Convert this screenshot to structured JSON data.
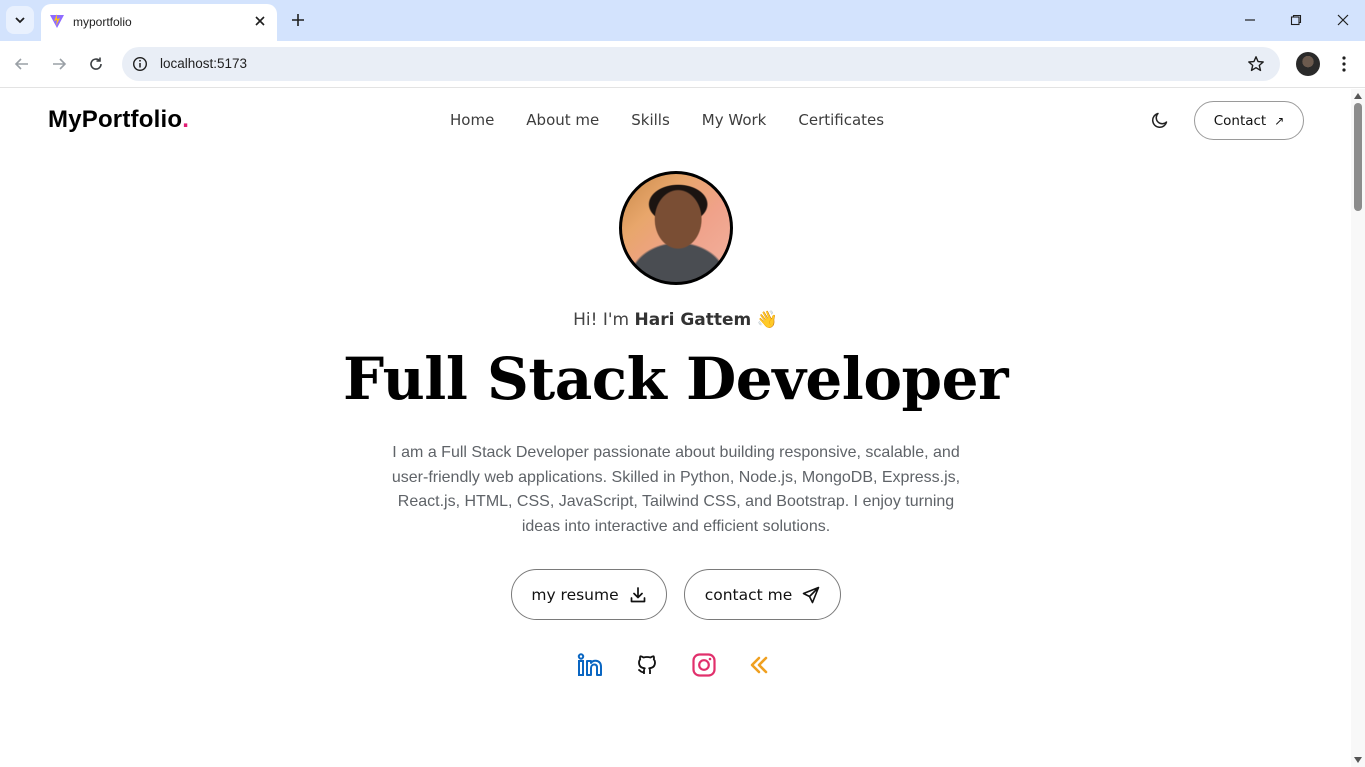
{
  "browser": {
    "tab_title": "myportfolio",
    "url": "localhost:5173"
  },
  "site": {
    "logo_text": "MyPortfolio",
    "logo_dot": ".",
    "nav": [
      "Home",
      "About me",
      "Skills",
      "My Work",
      "Certificates"
    ],
    "contact_label": "Contact",
    "contact_arrow": "↗"
  },
  "hero": {
    "greeting_prefix": "Hi! I'm",
    "name": "Hari Gattem",
    "wave": "👋",
    "headline": "Full Stack Developer",
    "intro": "I am a Full Stack Developer passionate about building responsive, scalable, and user-friendly web applications. Skilled in Python, Node.js, MongoDB, Express.js, React.js, HTML, CSS, JavaScript, Tailwind CSS, and Bootstrap. I enjoy turning ideas into interactive and efficient solutions.",
    "resume_label": "my resume",
    "contact_me_label": "contact me"
  },
  "social_icons": [
    "linkedin-icon",
    "github-icon",
    "instagram-icon",
    "leetcode-icon"
  ],
  "colors": {
    "accent_dot": "#e11d74",
    "linkedin": "#0a66c2",
    "instagram": "#e1306c",
    "leetcode": "#f0a020"
  }
}
